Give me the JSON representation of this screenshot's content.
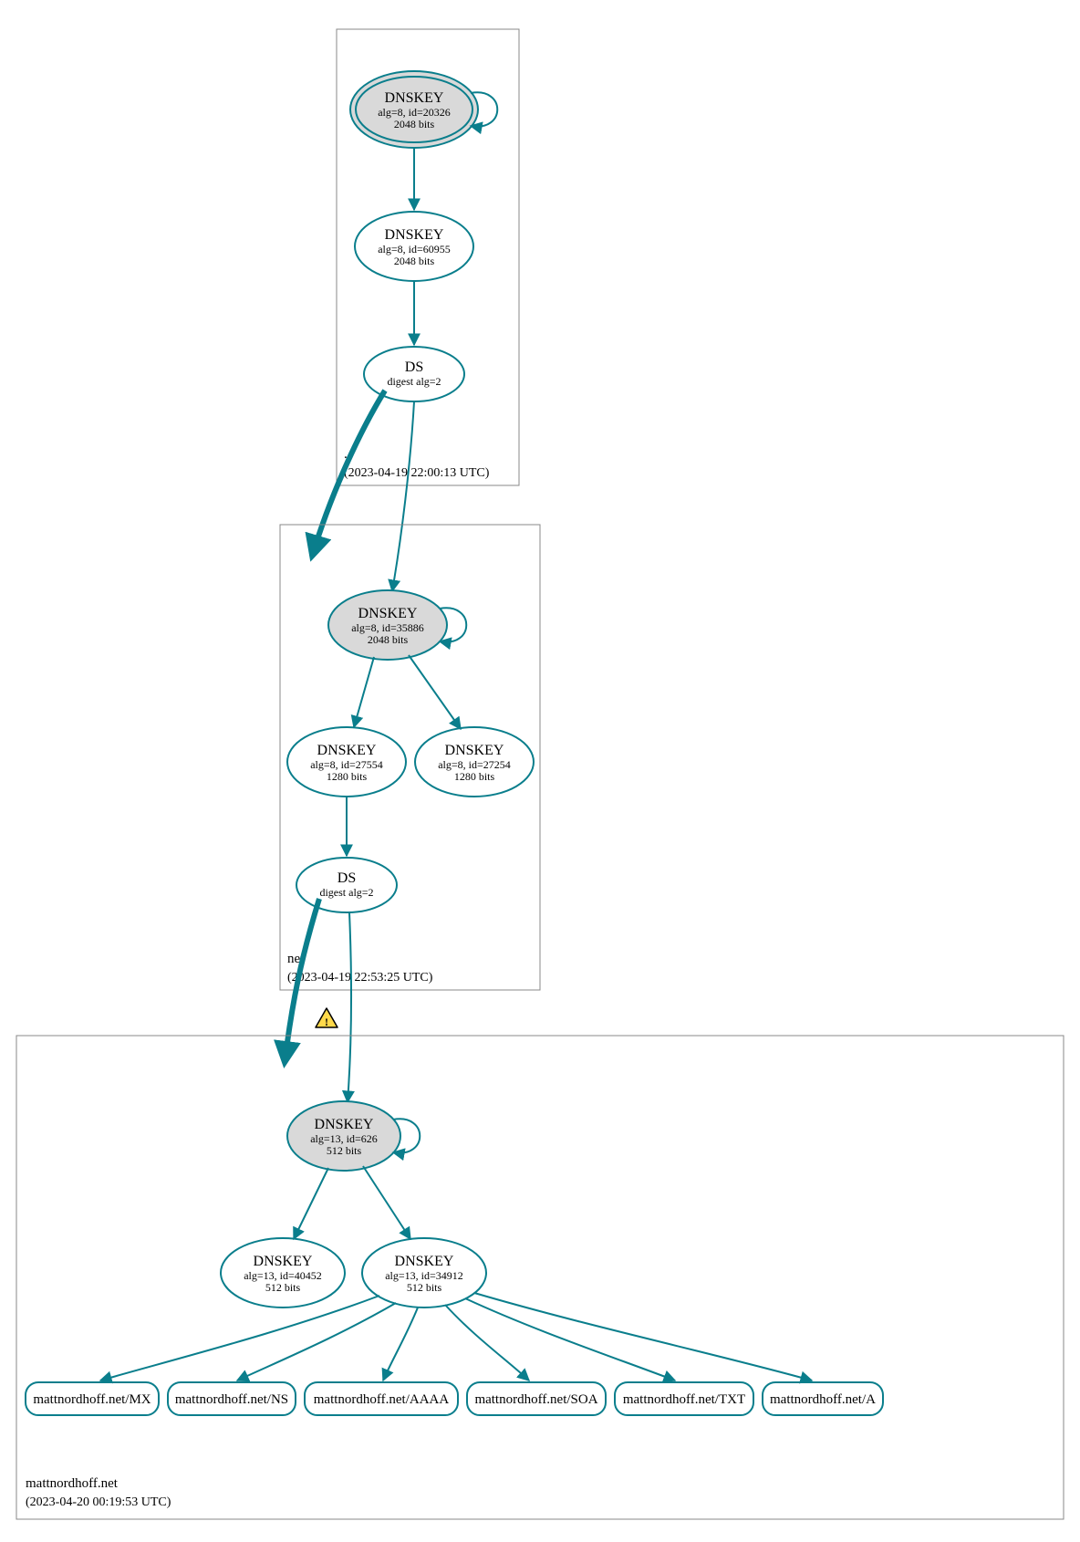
{
  "colors": {
    "stroke": "#0a7e8c",
    "fill_grey": "#d9d9d9",
    "fill_white": "#ffffff",
    "box": "#888888",
    "warn_fill": "#ffd94a",
    "warn_stroke": "#000000"
  },
  "zones": {
    "root": {
      "label": ".",
      "timestamp": "(2023-04-19 22:00:13 UTC)",
      "nodes": {
        "ksk": {
          "title": "DNSKEY",
          "line1": "alg=8, id=20326",
          "line2": "2048 bits"
        },
        "zsk": {
          "title": "DNSKEY",
          "line1": "alg=8, id=60955",
          "line2": "2048 bits"
        },
        "ds": {
          "title": "DS",
          "line1": "digest alg=2",
          "line2": ""
        }
      }
    },
    "net": {
      "label": "net",
      "timestamp": "(2023-04-19 22:53:25 UTC)",
      "nodes": {
        "ksk": {
          "title": "DNSKEY",
          "line1": "alg=8, id=35886",
          "line2": "2048 bits"
        },
        "zsk1": {
          "title": "DNSKEY",
          "line1": "alg=8, id=27554",
          "line2": "1280 bits"
        },
        "zsk2": {
          "title": "DNSKEY",
          "line1": "alg=8, id=27254",
          "line2": "1280 bits"
        },
        "ds": {
          "title": "DS",
          "line1": "digest alg=2",
          "line2": ""
        }
      }
    },
    "domain": {
      "label": "mattnordhoff.net",
      "timestamp": "(2023-04-20 00:19:53 UTC)",
      "nodes": {
        "ksk": {
          "title": "DNSKEY",
          "line1": "alg=13, id=626",
          "line2": "512 bits"
        },
        "zsk1": {
          "title": "DNSKEY",
          "line1": "alg=13, id=40452",
          "line2": "512 bits"
        },
        "zsk2": {
          "title": "DNSKEY",
          "line1": "alg=13, id=34912",
          "line2": "512 bits"
        }
      },
      "rrsets": {
        "mx": "mattnordhoff.net/MX",
        "ns": "mattnordhoff.net/NS",
        "aaaa": "mattnordhoff.net/AAAA",
        "soa": "mattnordhoff.net/SOA",
        "txt": "mattnordhoff.net/TXT",
        "a": "mattnordhoff.net/A"
      }
    }
  }
}
